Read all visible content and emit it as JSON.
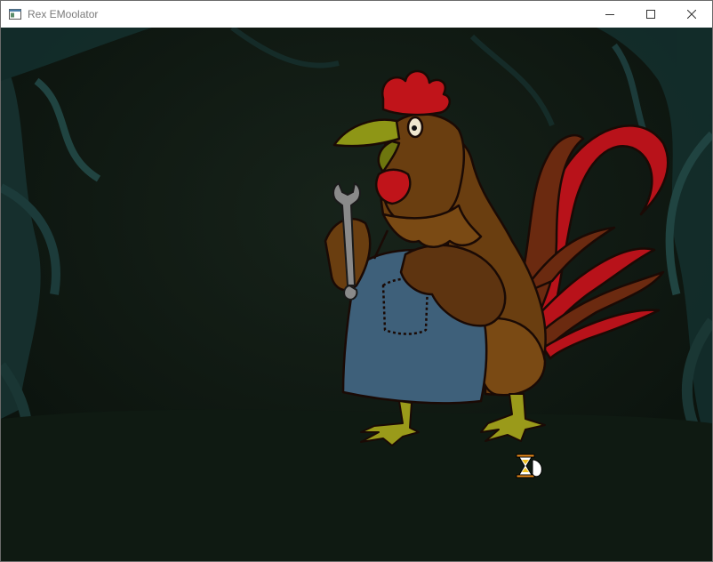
{
  "window": {
    "title": "Rex EMoolator",
    "controls": {
      "minimize_icon": "minimize-icon",
      "maximize_icon": "maximize-icon",
      "close_icon": "close-icon"
    }
  },
  "scene": {
    "character": "rooster-mechanic",
    "prop": "wrench",
    "cursor": "hourglass-wait-cursor",
    "colors": {
      "background": "#0d150f",
      "ground": "#0f1a12",
      "rooster_body": "#6a3e10",
      "comb": "#c0141a",
      "beak": "#8e9616",
      "overalls": "#3e607a",
      "tail_red": "#b8121a",
      "tail_brown": "#6b2a10",
      "feet": "#9a9a1a"
    }
  }
}
